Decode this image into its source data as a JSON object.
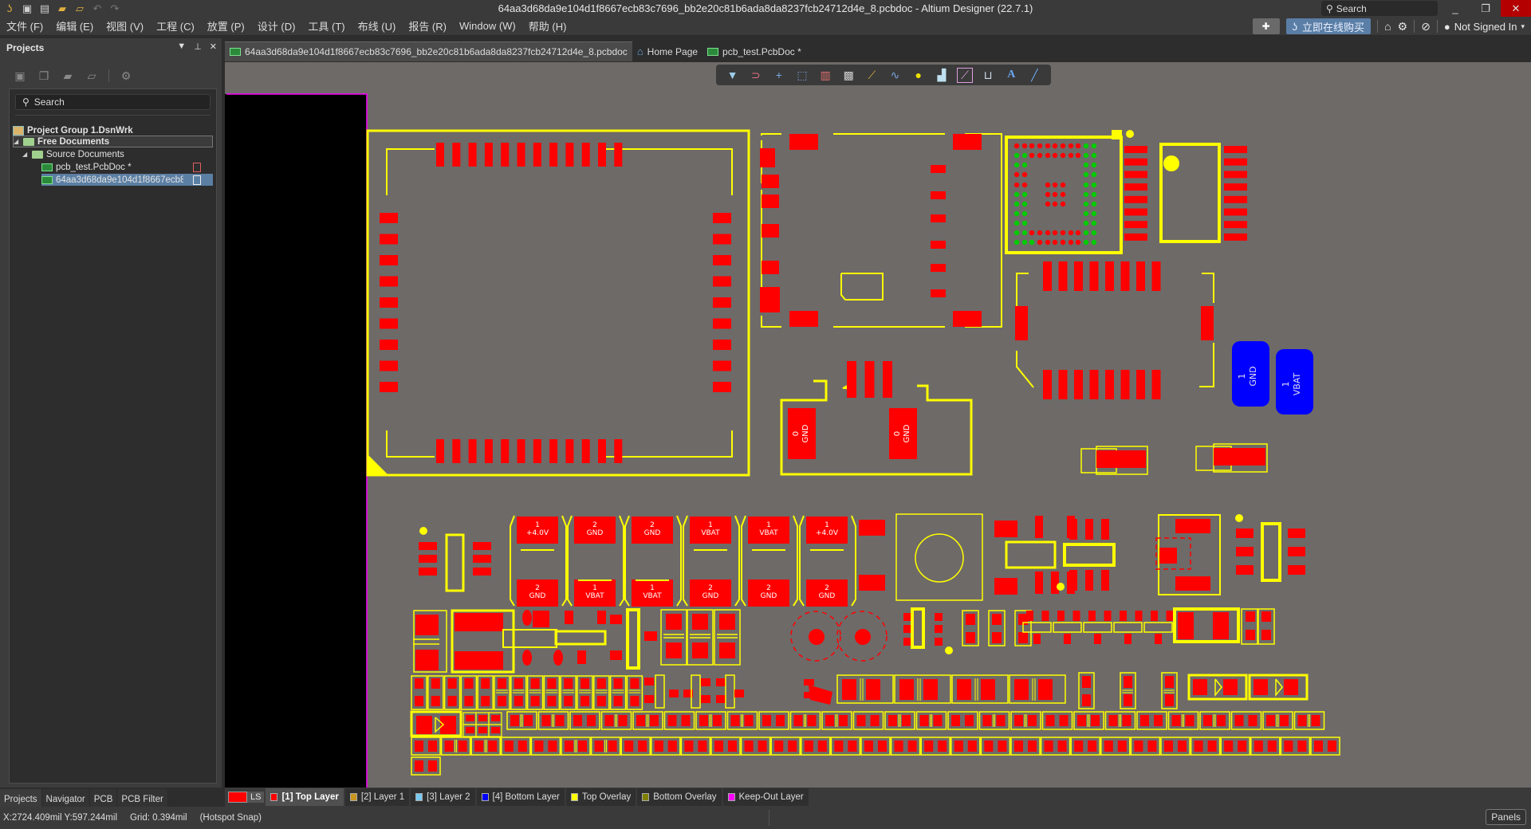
{
  "titlebar": {
    "title": "64aa3d68da9e104d1f8667ecb83c7696_bb2e20c81b6ada8da8237fcb24712d4e_8.pcbdoc - Altium Designer (22.7.1)",
    "search_placeholder": "Search",
    "quick_access": [
      "altium-logo-icon",
      "save-icon",
      "save-all-icon",
      "open-icon",
      "open-project-icon",
      "undo-icon",
      "redo-icon"
    ]
  },
  "menubar": {
    "items": [
      "文件 (F)",
      "编辑 (E)",
      "视图 (V)",
      "工程 (C)",
      "放置 (P)",
      "设计 (D)",
      "工具 (T)",
      "布线 (U)",
      "报告 (R)",
      "Window (W)",
      "帮助 (H)"
    ],
    "buy_label": "立即在线购买",
    "user_label": "Not Signed In"
  },
  "projects_panel": {
    "title": "Projects",
    "search_placeholder": "Search",
    "tree": [
      {
        "label": "Project Group 1.DsnWrk",
        "level": 0,
        "type": "group",
        "bold": true
      },
      {
        "label": "Free Documents",
        "level": 1,
        "type": "folder",
        "bold": true,
        "outlined": true
      },
      {
        "label": "Source Documents",
        "level": 2,
        "type": "folder"
      },
      {
        "label": "pcb_test.PcbDoc *",
        "level": 3,
        "type": "pcb",
        "modified": true
      },
      {
        "label": "64aa3d68da9e104d1f8667ecb8:",
        "level": 3,
        "type": "pcb",
        "selected": true
      }
    ],
    "bottom_tabs": [
      "Projects",
      "Navigator",
      "PCB",
      "PCB Filter"
    ],
    "active_bottom_tab": "Projects"
  },
  "doc_tabs": [
    {
      "label": "64aa3d68da9e104d1f8667ecb83c7696_bb2e20c81b6ada8da8237fcb24712d4e_8.pcbdoc",
      "icon": "pcb-doc-icon",
      "active": true
    },
    {
      "label": "Home Page",
      "icon": "home-icon",
      "active": false
    },
    {
      "label": "pcb_test.PcbDoc *",
      "icon": "pcb-doc-icon",
      "active": false
    }
  ],
  "pcb_toolbar": [
    "filter",
    "interactive-routing-magnet",
    "place-cross",
    "select-rect",
    "align",
    "place-component",
    "route",
    "diff-pair",
    "via",
    "polygon",
    "line",
    "dimension",
    "text",
    "line-draw"
  ],
  "pcb": {
    "pad_labels": {
      "cap_top": [
        [
          "1",
          "+4.0V"
        ],
        [
          "2",
          "GND"
        ],
        [
          "2",
          "GND"
        ],
        [
          "1",
          "VBAT"
        ],
        [
          "1",
          "VBAT"
        ],
        [
          "1",
          "+4.0V"
        ]
      ],
      "cap_bottom": [
        [
          "2",
          "GND"
        ],
        [
          "1",
          "VBAT"
        ],
        [
          "1",
          "VBAT"
        ],
        [
          "2",
          "GND"
        ],
        [
          "2",
          "GND"
        ],
        [
          "2",
          "GND"
        ]
      ],
      "usb_pads": [
        [
          "0",
          "GND"
        ],
        [
          "0",
          "GND"
        ]
      ],
      "battery_pads": [
        [
          "1",
          "GND"
        ],
        [
          "1",
          "VBAT"
        ]
      ]
    },
    "colors": {
      "board": "#6e6a68",
      "top_layer": "#ff0000",
      "top_overlay": "#ffff00",
      "bottom_layer": "#0000ff",
      "keepout": "#ff00ff",
      "via_green": "#00cc00"
    }
  },
  "layer_bar": {
    "ls_label": "LS",
    "layers": [
      {
        "label": "[1] Top Layer",
        "color": "#ff0000",
        "active": true
      },
      {
        "label": "[2] Layer 1",
        "color": "#c8961e",
        "active": false
      },
      {
        "label": "[3] Layer 2",
        "color": "#78c8f0",
        "active": false
      },
      {
        "label": "[4] Bottom Layer",
        "color": "#0000ff",
        "active": false
      },
      {
        "label": "Top Overlay",
        "color": "#ffff00",
        "active": false
      },
      {
        "label": "Bottom Overlay",
        "color": "#808000",
        "active": false
      },
      {
        "label": "Keep-Out Layer",
        "color": "#ff00ff",
        "active": false
      }
    ]
  },
  "status_bar": {
    "coords": "X:2724.409mil Y:597.244mil",
    "grid": "Grid: 0.394mil",
    "snap": "(Hotspot Snap)",
    "panels_label": "Panels"
  }
}
